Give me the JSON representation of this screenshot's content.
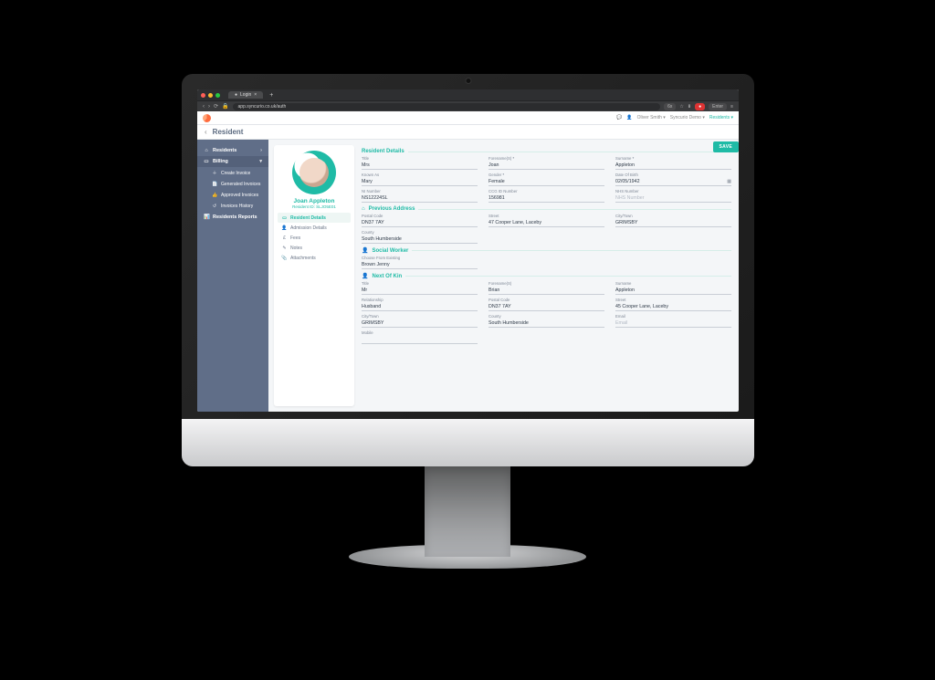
{
  "browser": {
    "tab_label": "Login",
    "url": "app.syncurio.co.uk/auth",
    "ext1": "6x",
    "enter_label": "Enter"
  },
  "topbar": {
    "user": "Oliver Smith",
    "org": "Syncurio Demo",
    "scope": "Residents"
  },
  "page": {
    "title": "Resident"
  },
  "sidebar": {
    "residents": "Residents",
    "billing": "Billing",
    "create_invoice": "Create Invoice",
    "generated": "Generated Invoices",
    "approved": "Approved Invoices",
    "history": "Invoices History",
    "reports": "Residents Reports"
  },
  "resident_card": {
    "name": "Joan Appleton",
    "id_line": "Resident ID: SLJO5E01",
    "tabs": {
      "details": "Resident Details",
      "admission": "Admission Details",
      "fees": "Fees",
      "notes": "Notes",
      "attachments": "Attachments"
    }
  },
  "save_label": "SAVE",
  "sections": {
    "details": "Resident Details",
    "prev_addr": "Previous Address",
    "social": "Social Worker",
    "nok": "Next Of Kin"
  },
  "labels": {
    "title": "Title",
    "forename": "Forename(S)",
    "surname": "Surname",
    "known_as": "Known As",
    "gender": "Gender",
    "dob": "Date Of Birth",
    "ni": "NI Number",
    "ccg": "CCG ID Number",
    "nhs": "NHS Number",
    "nhs_ph": "NHS Number",
    "postal": "Postal Code",
    "street": "Street",
    "citytown": "City/Town",
    "county": "County",
    "choose_existing": "Choose From Existing",
    "relationship": "Relationship",
    "email": "Email",
    "email_ph": "Email",
    "mobile": "Mobile"
  },
  "values": {
    "title": "Mrs",
    "forename": "Joan",
    "surname": "Appleton",
    "known_as": "Mary",
    "gender": "Female",
    "dob": "02/05/1942",
    "ni": "NS12224SL",
    "ccg": "156981",
    "prev_postal": "DN37 7AY",
    "prev_street": "47 Cooper Lane, Laceby",
    "prev_city": "GRIMSBY",
    "prev_county": "South Humberside",
    "social_worker": "Brown Jenny",
    "nok_title": "Mr",
    "nok_forename": "Brian",
    "nok_surname": "Appleton",
    "nok_rel": "Husband",
    "nok_postal": "DN37 7AY",
    "nok_street": "45 Cooper Lane, Laceby",
    "nok_city": "GRIMSBY",
    "nok_county": "South Humberside"
  }
}
